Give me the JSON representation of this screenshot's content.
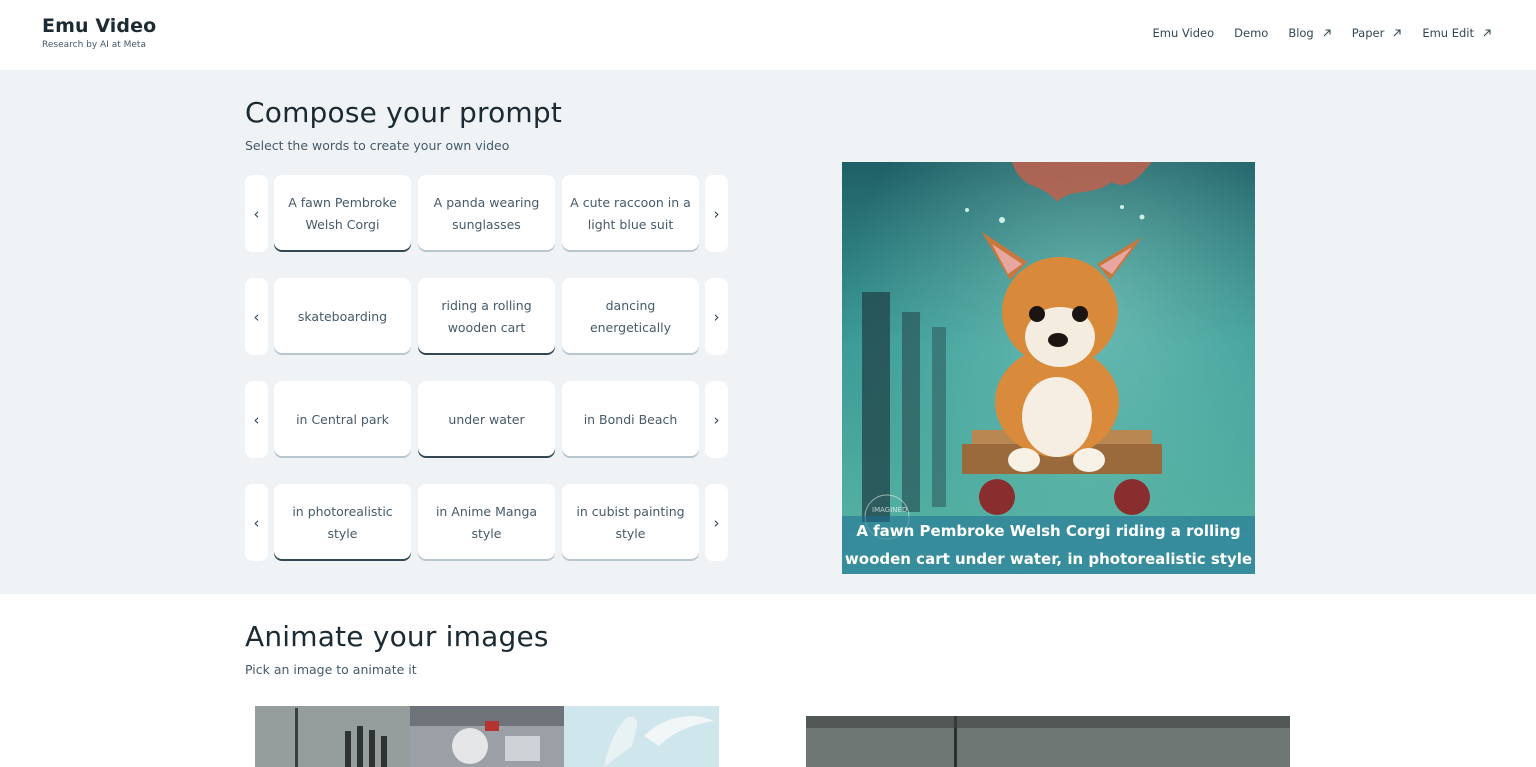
{
  "brand": {
    "title": "Emu Video",
    "subtitle": "Research by AI at Meta"
  },
  "nav": [
    {
      "label": "Emu Video",
      "external": false,
      "icon": ""
    },
    {
      "label": "Demo",
      "external": false,
      "icon": ""
    },
    {
      "label": "Blog",
      "external": true,
      "icon": "external-link-icon"
    },
    {
      "label": "Paper",
      "external": true,
      "icon": "external-link-icon"
    },
    {
      "label": "Emu Edit",
      "external": true,
      "icon": "external-link-icon"
    }
  ],
  "compose": {
    "title": "Compose your prompt",
    "subtitle": "Select the words to create your own video",
    "arrows": {
      "prev": "‹",
      "next": "›"
    },
    "rows": [
      {
        "options": [
          "A fawn Pembroke Welsh Corgi",
          "A panda wearing sunglasses",
          "A cute raccoon in a light blue suit"
        ],
        "selected": 0
      },
      {
        "options": [
          "skateboarding",
          "riding a rolling wooden cart",
          "dancing energetically"
        ],
        "selected": 1
      },
      {
        "options": [
          "in Central park",
          "under water",
          "in Bondi Beach"
        ],
        "selected": 1
      },
      {
        "options": [
          "in photorealistic style",
          "in Anime Manga style",
          "in cubist painting style"
        ],
        "selected": 0
      }
    ],
    "caption": "A fawn Pembroke Welsh Corgi riding a rolling wooden cart under water, in photorealistic style",
    "watermark": "IMAGINED",
    "colors": {
      "selected_border": "#344854",
      "unselected_border": "#b8c6d0",
      "section_bg": "#f0f3f6"
    }
  },
  "animate": {
    "title": "Animate your images",
    "subtitle": "Pick an image to animate it"
  }
}
